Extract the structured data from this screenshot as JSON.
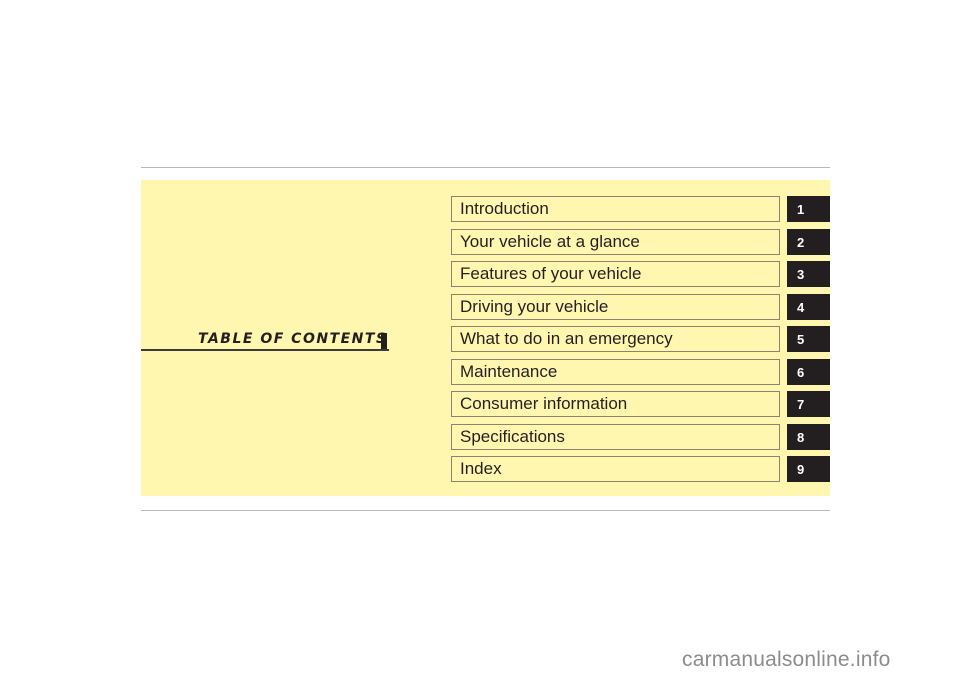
{
  "title": "TABLE OF CONTENTS",
  "chapters": [
    {
      "label": "Introduction",
      "number": "1"
    },
    {
      "label": "Your vehicle at a glance",
      "number": "2"
    },
    {
      "label": "Features of your vehicle",
      "number": "3"
    },
    {
      "label": "Driving your vehicle",
      "number": "4"
    },
    {
      "label": "What to do in an emergency",
      "number": "5"
    },
    {
      "label": "Maintenance",
      "number": "6"
    },
    {
      "label": "Consumer information",
      "number": "7"
    },
    {
      "label": "Specifications",
      "number": "8"
    },
    {
      "label": "Index",
      "number": "9"
    }
  ],
  "watermark": "carmanualsonline.info",
  "colors": {
    "panel": "#fff6b0",
    "tab": "#231f20"
  }
}
